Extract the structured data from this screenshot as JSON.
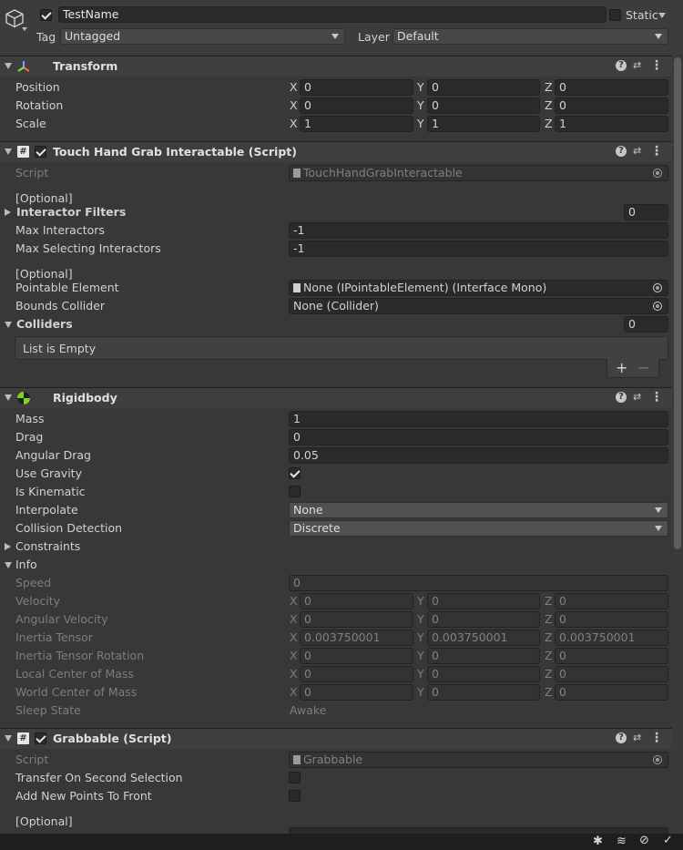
{
  "header": {
    "name": "TestName",
    "static_label": "Static",
    "tag_label": "Tag",
    "tag_value": "Untagged",
    "layer_label": "Layer",
    "layer_value": "Default"
  },
  "axes": {
    "x": "X",
    "y": "Y",
    "z": "Z"
  },
  "transform": {
    "title": "Transform",
    "rows": [
      {
        "label": "Position",
        "x": "0",
        "y": "0",
        "z": "0"
      },
      {
        "label": "Rotation",
        "x": "0",
        "y": "0",
        "z": "0"
      },
      {
        "label": "Scale",
        "x": "1",
        "y": "1",
        "z": "1"
      }
    ]
  },
  "touch": {
    "title": "Touch Hand Grab Interactable (Script)",
    "script_label": "Script",
    "script_value": "TouchHandGrabInteractable",
    "optional1": "[Optional]",
    "interactor_filters_label": "Interactor Filters",
    "interactor_filters_count": "0",
    "max_interactors_label": "Max Interactors",
    "max_interactors_value": "-1",
    "max_selecting_label": "Max Selecting Interactors",
    "max_selecting_value": "-1",
    "optional2": "[Optional]",
    "pointable_label": "Pointable Element",
    "pointable_value": "None (IPointableElement) (Interface Mono)",
    "bounds_label": "Bounds Collider",
    "bounds_value": "None (Collider)",
    "colliders_label": "Colliders",
    "colliders_count": "0",
    "list_empty": "List is Empty",
    "add": "+",
    "remove": "−"
  },
  "rigidbody": {
    "title": "Rigidbody",
    "mass_label": "Mass",
    "mass": "1",
    "drag_label": "Drag",
    "drag": "0",
    "angular_drag_label": "Angular Drag",
    "angular_drag": "0.05",
    "use_gravity_label": "Use Gravity",
    "use_gravity": true,
    "is_kinematic_label": "Is Kinematic",
    "is_kinematic": false,
    "interpolate_label": "Interpolate",
    "interpolate": "None",
    "collision_label": "Collision Detection",
    "collision": "Discrete",
    "constraints_label": "Constraints",
    "info_label": "Info",
    "speed_label": "Speed",
    "speed": "0",
    "info_rows": [
      {
        "label": "Velocity",
        "x": "0",
        "y": "0",
        "z": "0"
      },
      {
        "label": "Angular Velocity",
        "x": "0",
        "y": "0",
        "z": "0"
      },
      {
        "label": "Inertia Tensor",
        "x": "0.003750001",
        "y": "0.003750001",
        "z": "0.003750001"
      },
      {
        "label": "Inertia Tensor Rotation",
        "x": "0",
        "y": "0",
        "z": "0"
      },
      {
        "label": "Local Center of Mass",
        "x": "0",
        "y": "0",
        "z": "0"
      },
      {
        "label": "World Center of Mass",
        "x": "0",
        "y": "0",
        "z": "0"
      }
    ],
    "sleep_label": "Sleep State",
    "sleep": "Awake"
  },
  "grabbable": {
    "title": "Grabbable (Script)",
    "script_label": "Script",
    "script_value": "Grabbable",
    "transfer_label": "Transfer On Second Selection",
    "add_front_label": "Add New Points To Front",
    "optional": "[Optional]"
  },
  "colors": {
    "background": "#383838",
    "header": "#3e3e3e",
    "field": "#2a2a2a",
    "text": "#d2d2d2"
  }
}
